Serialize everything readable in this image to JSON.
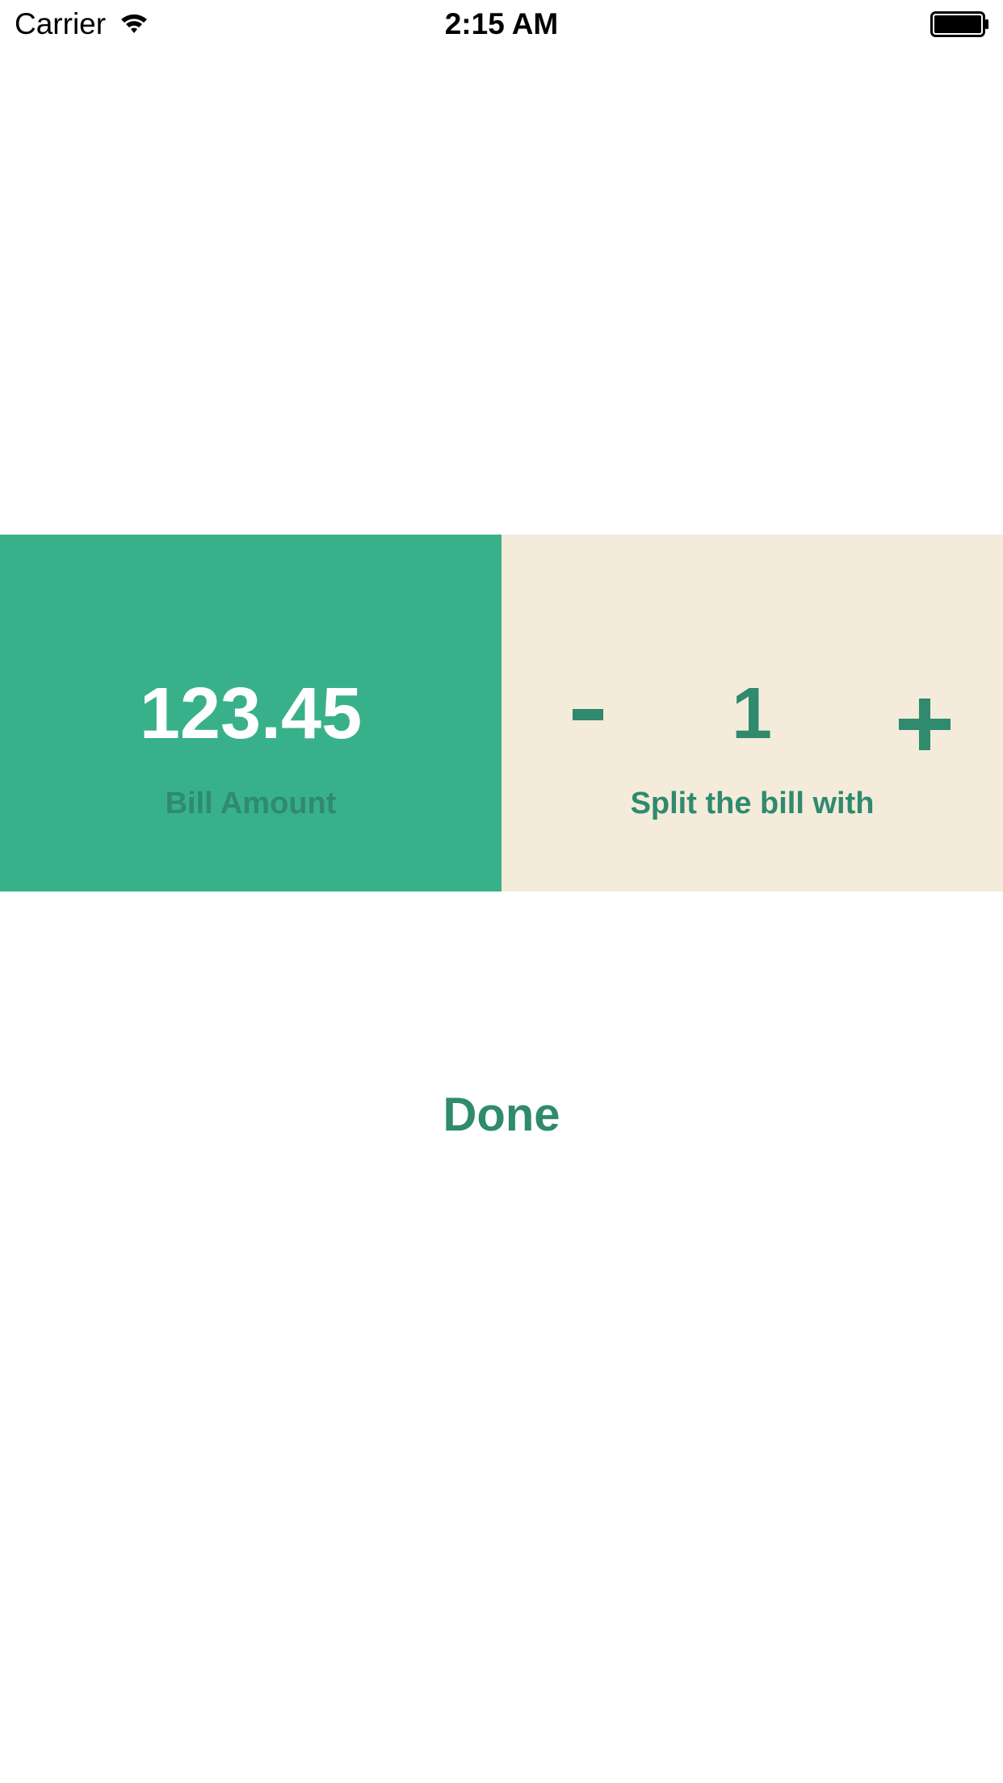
{
  "status_bar": {
    "carrier": "Carrier",
    "time": "2:15 AM",
    "icons": [
      "wifi-icon",
      "battery-icon"
    ]
  },
  "bill": {
    "amount": "123.45",
    "label": "Bill Amount"
  },
  "split": {
    "decrement_label": "-",
    "count": "1",
    "increment_label": "+",
    "label": "Split the bill with"
  },
  "done_button": {
    "label": "Done"
  },
  "colors": {
    "accent_green": "#38b18b",
    "dark_green_text": "#2f8a6e",
    "cream": "#f4ebdb",
    "background": "#ffffff"
  }
}
